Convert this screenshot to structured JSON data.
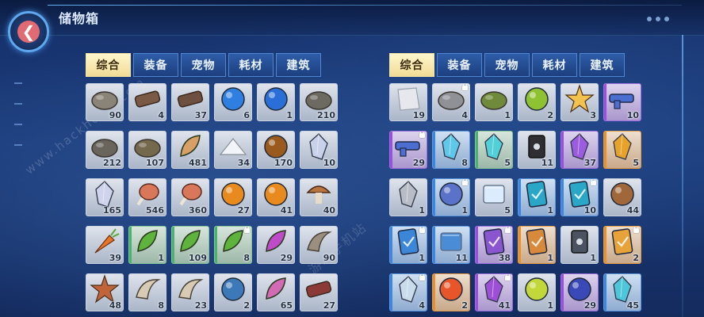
{
  "header": {
    "title": "储物箱"
  },
  "watermark": {
    "text": "www.hackhome.com",
    "text2": "游戏手机站"
  },
  "left_panel": {
    "tabs": [
      {
        "label": "综合",
        "active": true
      },
      {
        "label": "装备",
        "active": false
      },
      {
        "label": "宠物",
        "active": false
      },
      {
        "label": "耗材",
        "active": false
      },
      {
        "label": "建筑",
        "active": false
      }
    ],
    "items": [
      {
        "icon": "bone-ore-icon",
        "count": "90",
        "quality": "gray",
        "locked": false,
        "color": "#8a8378",
        "shape": "rock"
      },
      {
        "icon": "wood-log-icon",
        "count": "4",
        "quality": "gray",
        "locked": false,
        "color": "#7a5a44",
        "shape": "log"
      },
      {
        "icon": "wood-log-icon",
        "count": "37",
        "quality": "gray",
        "locked": false,
        "color": "#6e5040",
        "shape": "log"
      },
      {
        "icon": "blue-vortex-icon",
        "count": "6",
        "quality": "gray",
        "locked": false,
        "color": "#2f7fe0",
        "shape": "orb"
      },
      {
        "icon": "blue-vortex-icon",
        "count": "1",
        "quality": "gray",
        "locked": false,
        "color": "#2a6fd8",
        "shape": "orb"
      },
      {
        "icon": "stone-pile-icon",
        "count": "210",
        "quality": "gray",
        "locked": false,
        "color": "#6d6a62",
        "shape": "rock"
      },
      {
        "icon": "stone-pile-icon",
        "count": "212",
        "quality": "gray",
        "locked": false,
        "color": "#6a655c",
        "shape": "rock"
      },
      {
        "icon": "stone-pile-icon",
        "count": "107",
        "quality": "gray",
        "locked": false,
        "color": "#74684d",
        "shape": "rock"
      },
      {
        "icon": "fur-tuft-icon",
        "count": "481",
        "quality": "gray",
        "locked": false,
        "color": "#d9a066",
        "shape": "leaf"
      },
      {
        "icon": "salt-pile-icon",
        "count": "34",
        "quality": "gray",
        "locked": false,
        "color": "#f1f4f8",
        "shape": "mound"
      },
      {
        "icon": "nuts-icon",
        "count": "170",
        "quality": "gray",
        "locked": false,
        "color": "#9a5a1e",
        "shape": "orb"
      },
      {
        "icon": "crystal-shard-icon",
        "count": "10",
        "quality": "gray",
        "locked": false,
        "color": "#c9d0ea",
        "shape": "crystal"
      },
      {
        "icon": "crystal-shard-icon",
        "count": "165",
        "quality": "gray",
        "locked": false,
        "color": "#cfd3ec",
        "shape": "crystal"
      },
      {
        "icon": "meat-icon",
        "count": "546",
        "quality": "gray",
        "locked": false,
        "color": "#d8775a",
        "shape": "meat"
      },
      {
        "icon": "meat-icon",
        "count": "360",
        "quality": "gray",
        "locked": false,
        "color": "#d8775a",
        "shape": "meat"
      },
      {
        "icon": "pumpkin-icon",
        "count": "27",
        "quality": "gray",
        "locked": false,
        "color": "#e88a1e",
        "shape": "orb"
      },
      {
        "icon": "pumpkin-icon",
        "count": "41",
        "quality": "gray",
        "locked": false,
        "color": "#e88a1e",
        "shape": "orb"
      },
      {
        "icon": "mushroom-icon",
        "count": "40",
        "quality": "gray",
        "locked": false,
        "color": "#b8743e",
        "shape": "mushroom"
      },
      {
        "icon": "carrot-icon",
        "count": "39",
        "quality": "gray",
        "locked": false,
        "color": "#e9752a",
        "shape": "carrot"
      },
      {
        "icon": "herb-leaves-icon",
        "count": "1",
        "quality": "green",
        "locked": false,
        "color": "#5db33c",
        "shape": "leaf"
      },
      {
        "icon": "herb-leaves-icon",
        "count": "109",
        "quality": "green",
        "locked": false,
        "color": "#5db33c",
        "shape": "leaf"
      },
      {
        "icon": "herb-leaves-icon",
        "count": "8",
        "quality": "green",
        "locked": true,
        "color": "#5db33c",
        "shape": "leaf"
      },
      {
        "icon": "feather-icon",
        "count": "29",
        "quality": "gray",
        "locked": false,
        "color": "#c04bc8",
        "shape": "leaf"
      },
      {
        "icon": "horn-icon",
        "count": "90",
        "quality": "gray",
        "locked": false,
        "color": "#9b9080",
        "shape": "horn"
      },
      {
        "icon": "starfish-icon",
        "count": "48",
        "quality": "gray",
        "locked": false,
        "color": "#c2643a",
        "shape": "star"
      },
      {
        "icon": "beast-skull-icon",
        "count": "8",
        "quality": "gray",
        "locked": false,
        "color": "#d7cbb4",
        "shape": "horn"
      },
      {
        "icon": "beast-skull-icon",
        "count": "23",
        "quality": "gray",
        "locked": false,
        "color": "#d7cbb4",
        "shape": "horn"
      },
      {
        "icon": "blue-egg-icon",
        "count": "2",
        "quality": "gray",
        "locked": false,
        "color": "#3d78b8",
        "shape": "orb"
      },
      {
        "icon": "pink-tentacle-icon",
        "count": "65",
        "quality": "gray",
        "locked": false,
        "color": "#d36ab5",
        "shape": "leaf"
      },
      {
        "icon": "log-icon",
        "count": "27",
        "quality": "gray",
        "locked": false,
        "color": "#8c3a38",
        "shape": "log"
      }
    ]
  },
  "right_panel": {
    "tabs": [
      {
        "label": "综合",
        "active": true
      },
      {
        "label": "装备",
        "active": false
      },
      {
        "label": "宠物",
        "active": false
      },
      {
        "label": "耗材",
        "active": false
      },
      {
        "label": "建筑",
        "active": false
      }
    ],
    "items": [
      {
        "icon": "paper-icon",
        "count": "19",
        "quality": "gray",
        "locked": false,
        "color": "#e6e8ee",
        "shape": "paper"
      },
      {
        "icon": "metal-scrap-icon",
        "count": "4",
        "quality": "gray",
        "locked": true,
        "color": "#8f9196",
        "shape": "rock"
      },
      {
        "icon": "mossy-rock-icon",
        "count": "1",
        "quality": "gray",
        "locked": false,
        "color": "#6f8a3a",
        "shape": "rock"
      },
      {
        "icon": "green-bowl-icon",
        "count": "2",
        "quality": "gray",
        "locked": false,
        "color": "#8fc232",
        "shape": "orb"
      },
      {
        "icon": "gold-scraps-icon",
        "count": "3",
        "quality": "gray",
        "locked": false,
        "color": "#f2c14e",
        "shape": "star"
      },
      {
        "icon": "blaster-icon",
        "count": "10",
        "quality": "purple",
        "locked": false,
        "color": "#4c6ed0",
        "shape": "gun"
      },
      {
        "icon": "blaster-icon",
        "count": "29",
        "quality": "purple",
        "locked": true,
        "color": "#4c6ed0",
        "shape": "gun"
      },
      {
        "icon": "ice-crystal-icon",
        "count": "8",
        "quality": "blue",
        "locked": false,
        "color": "#5fc7ea",
        "shape": "crystal"
      },
      {
        "icon": "cyan-shard-icon",
        "count": "5",
        "quality": "green",
        "locked": false,
        "color": "#52d0d8",
        "shape": "crystal"
      },
      {
        "icon": "canister-icon",
        "count": "11",
        "quality": "gray",
        "locked": false,
        "color": "#2e2e33",
        "shape": "canister"
      },
      {
        "icon": "violet-shard-icon",
        "count": "37",
        "quality": "purple",
        "locked": false,
        "color": "#9c5ce0",
        "shape": "crystal"
      },
      {
        "icon": "amber-shard-icon",
        "count": "5",
        "quality": "orange",
        "locked": false,
        "color": "#e7a22a",
        "shape": "crystal"
      },
      {
        "icon": "steel-shard-icon",
        "count": "1",
        "quality": "gray",
        "locked": false,
        "color": "#b8bcc6",
        "shape": "crystal"
      },
      {
        "icon": "planet-token-icon",
        "count": "1",
        "quality": "blue",
        "locked": true,
        "color": "#5b72c9",
        "shape": "orb"
      },
      {
        "icon": "ice-block-icon",
        "count": "5",
        "quality": "gray",
        "locked": false,
        "color": "#dcecff",
        "shape": "block"
      },
      {
        "icon": "check-card-icon",
        "count": "1",
        "quality": "blue",
        "locked": false,
        "color": "#2aa6c6",
        "shape": "card"
      },
      {
        "icon": "check-card-icon",
        "count": "10",
        "quality": "blue",
        "locked": true,
        "color": "#2aa6c6",
        "shape": "card"
      },
      {
        "icon": "pinecone-icon",
        "count": "44",
        "quality": "gray",
        "locked": false,
        "color": "#a0673a",
        "shape": "orb"
      },
      {
        "icon": "blue-scroll-icon",
        "count": "1",
        "quality": "blue",
        "locked": true,
        "color": "#3c86d8",
        "shape": "card"
      },
      {
        "icon": "blue-chest-icon",
        "count": "11",
        "quality": "blue",
        "locked": false,
        "color": "#4a8cd6",
        "shape": "block"
      },
      {
        "icon": "purple-card-icon",
        "count": "38",
        "quality": "purple",
        "locked": true,
        "color": "#8a56d0",
        "shape": "card"
      },
      {
        "icon": "orange-card-icon",
        "count": "1",
        "quality": "orange",
        "locked": false,
        "color": "#d88a3c",
        "shape": "card"
      },
      {
        "icon": "drone-icon",
        "count": "1",
        "quality": "gray",
        "locked": false,
        "color": "#4b5260",
        "shape": "canister"
      },
      {
        "icon": "gold-card-icon",
        "count": "2",
        "quality": "orange",
        "locked": true,
        "color": "#e8a23a",
        "shape": "card"
      },
      {
        "icon": "glass-shard-icon",
        "count": "4",
        "quality": "blue",
        "locked": true,
        "color": "#c8dcec",
        "shape": "crystal"
      },
      {
        "icon": "fire-orb-icon",
        "count": "2",
        "quality": "orange",
        "locked": false,
        "color": "#e7562a",
        "shape": "orb"
      },
      {
        "icon": "purple-gem-icon",
        "count": "41",
        "quality": "purple",
        "locked": true,
        "color": "#9d4fd6",
        "shape": "crystal"
      },
      {
        "icon": "apple-icon",
        "count": "1",
        "quality": "gray",
        "locked": false,
        "color": "#c2d83a",
        "shape": "orb"
      },
      {
        "icon": "dark-orb-icon",
        "count": "29",
        "quality": "purple",
        "locked": false,
        "color": "#3a48b8",
        "shape": "orb"
      },
      {
        "icon": "teal-crystals-icon",
        "count": "45",
        "quality": "blue",
        "locked": false,
        "color": "#4cc6d8",
        "shape": "crystal"
      }
    ]
  }
}
